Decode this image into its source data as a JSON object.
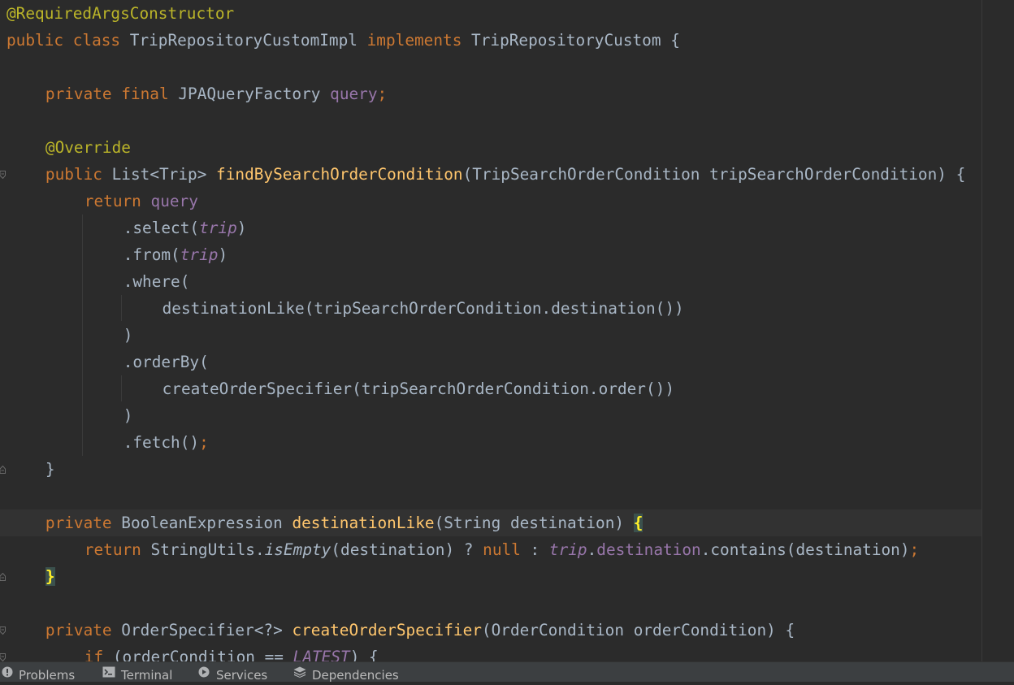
{
  "editor": {
    "lines": [
      [
        [
          "ann",
          "@RequiredArgsConstructor"
        ]
      ],
      [
        [
          "kw",
          "public class "
        ],
        [
          "pl",
          "TripRepositoryCustomImpl "
        ],
        [
          "kw",
          "implements "
        ],
        [
          "pl",
          "TripRepositoryCustom {"
        ]
      ],
      [],
      [
        [
          "kw",
          "private final "
        ],
        [
          "pl",
          "JPAQueryFactory "
        ],
        [
          "fld",
          "query"
        ],
        [
          "kw",
          ";"
        ]
      ],
      [],
      [
        [
          "ann",
          "@Override"
        ]
      ],
      [
        [
          "kw",
          "public "
        ],
        [
          "pl",
          "List<Trip> "
        ],
        [
          "fn",
          "findBySearchOrderCondition"
        ],
        [
          "pl",
          "(TripSearchOrderCondition tripSearchOrderCondition) {"
        ]
      ],
      [
        [
          "kw",
          "return "
        ],
        [
          "fld",
          "query"
        ]
      ],
      [
        [
          "pl",
          ".select("
        ],
        [
          "sfld",
          "trip"
        ],
        [
          "pl",
          ")"
        ]
      ],
      [
        [
          "pl",
          ".from("
        ],
        [
          "sfld",
          "trip"
        ],
        [
          "pl",
          ")"
        ]
      ],
      [
        [
          "pl",
          ".where("
        ]
      ],
      [
        [
          "pl",
          "destinationLike(tripSearchOrderCondition.destination())"
        ]
      ],
      [
        [
          "pl",
          ")"
        ]
      ],
      [
        [
          "pl",
          ".orderBy("
        ]
      ],
      [
        [
          "pl",
          "createOrderSpecifier(tripSearchOrderCondition.order())"
        ]
      ],
      [
        [
          "pl",
          ")"
        ]
      ],
      [
        [
          "pl",
          ".fetch()"
        ],
        [
          "kw",
          ";"
        ]
      ],
      [
        [
          "pl",
          "}"
        ]
      ],
      [],
      [
        [
          "kw",
          "private "
        ],
        [
          "pl",
          "BooleanExpression "
        ],
        [
          "fn",
          "destinationLike"
        ],
        [
          "pl",
          "(String destination) "
        ],
        [
          "brace-hl",
          "{"
        ]
      ],
      [
        [
          "kw",
          "return "
        ],
        [
          "pl",
          "StringUtils."
        ],
        [
          "sm",
          "isEmpty"
        ],
        [
          "pl",
          "(destination) ? "
        ],
        [
          "kw",
          "null "
        ],
        [
          "pl",
          ": "
        ],
        [
          "sfld",
          "trip"
        ],
        [
          "pl",
          "."
        ],
        [
          "fld",
          "destination"
        ],
        [
          "pl",
          ".contains(destination)"
        ],
        [
          "kw",
          ";"
        ]
      ],
      [
        [
          "brace-hl",
          "}"
        ]
      ],
      [],
      [
        [
          "kw",
          "private "
        ],
        [
          "pl",
          "OrderSpecifier<?> "
        ],
        [
          "fn",
          "createOrderSpecifier"
        ],
        [
          "pl",
          "(OrderCondition orderCondition) {"
        ]
      ],
      [
        [
          "kw",
          "if "
        ],
        [
          "pl",
          "(orderCondition == "
        ],
        [
          "sfld",
          "LATEST"
        ],
        [
          "pl",
          ") {"
        ]
      ]
    ],
    "indents": [
      0,
      0,
      0,
      1,
      0,
      1,
      1,
      2,
      3,
      3,
      3,
      4,
      3,
      3,
      4,
      3,
      3,
      1,
      0,
      1,
      2,
      1,
      0,
      1,
      2
    ]
  },
  "tool_windows": [
    {
      "label": "Problems",
      "icon": "problems-icon"
    },
    {
      "label": "Terminal",
      "icon": "terminal-icon"
    },
    {
      "label": "Services",
      "icon": "services-icon"
    },
    {
      "label": "Dependencies",
      "icon": "dependencies-icon"
    }
  ]
}
